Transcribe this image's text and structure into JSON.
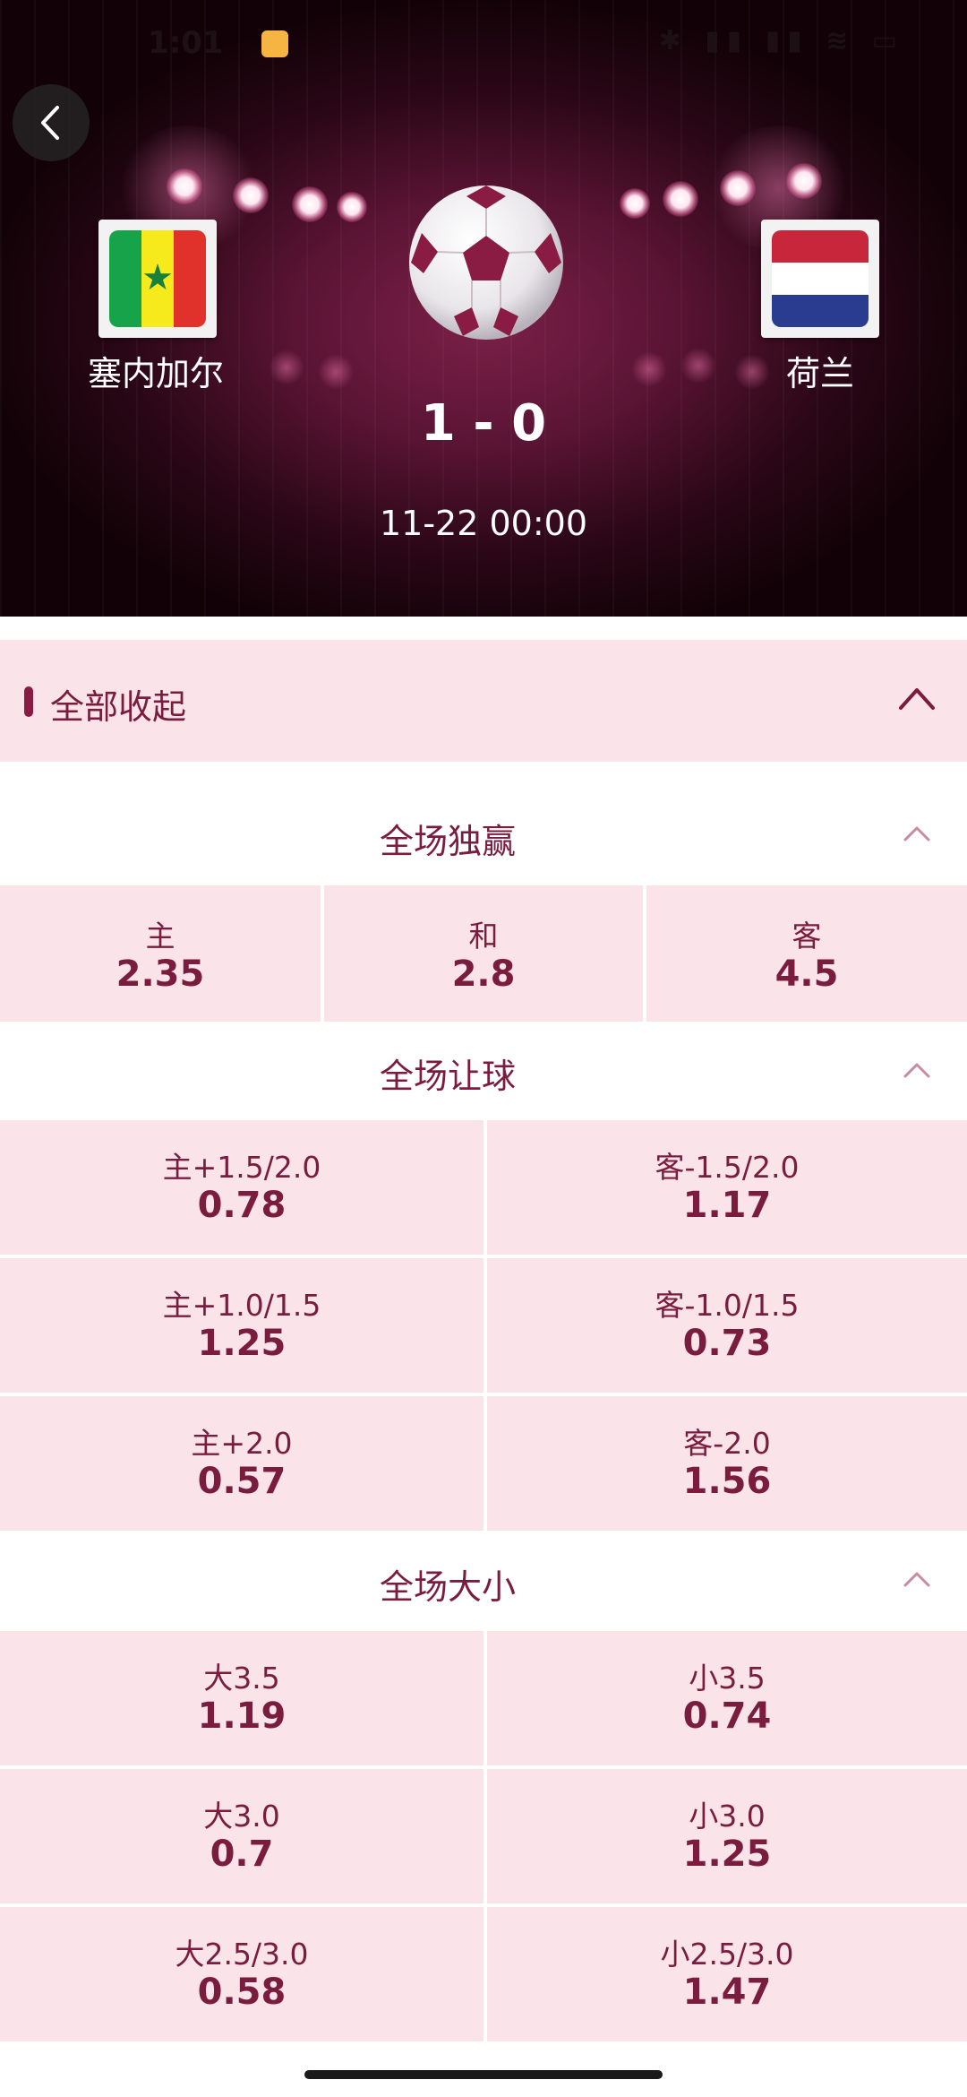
{
  "status_bar": {
    "time": "1:01",
    "icons": "✱ ▮▮ ▮▮ ≋ ▭"
  },
  "header": {
    "home_team": "塞内加尔",
    "away_team": "荷兰",
    "score": "1 - 0",
    "datetime": "11-22 00:00",
    "back_icon": "chevron-left-icon"
  },
  "collapse_all": {
    "label": "全部收起"
  },
  "sections": {
    "win": {
      "title": "全场独赢",
      "cells": [
        {
          "label": "主",
          "value": "2.35"
        },
        {
          "label": "和",
          "value": "2.8"
        },
        {
          "label": "客",
          "value": "4.5"
        }
      ]
    },
    "handicap": {
      "title": "全场让球",
      "rows": [
        [
          {
            "label": "主+1.5/2.0",
            "value": "0.78"
          },
          {
            "label": "客-1.5/2.0",
            "value": "1.17"
          }
        ],
        [
          {
            "label": "主+1.0/1.5",
            "value": "1.25"
          },
          {
            "label": "客-1.0/1.5",
            "value": "0.73"
          }
        ],
        [
          {
            "label": "主+2.0",
            "value": "0.57"
          },
          {
            "label": "客-2.0",
            "value": "1.56"
          }
        ]
      ]
    },
    "totals": {
      "title": "全场大小",
      "rows": [
        [
          {
            "label": "大3.5",
            "value": "1.19"
          },
          {
            "label": "小3.5",
            "value": "0.74"
          }
        ],
        [
          {
            "label": "大3.0",
            "value": "0.7"
          },
          {
            "label": "小3.0",
            "value": "1.25"
          }
        ],
        [
          {
            "label": "大2.5/3.0",
            "value": "0.58"
          },
          {
            "label": "小2.5/3.0",
            "value": "1.47"
          }
        ]
      ]
    }
  },
  "colors": {
    "accent": "#7a1c3e",
    "cell_bg": "#fae4ea",
    "hero_bg": "#5a1434"
  }
}
